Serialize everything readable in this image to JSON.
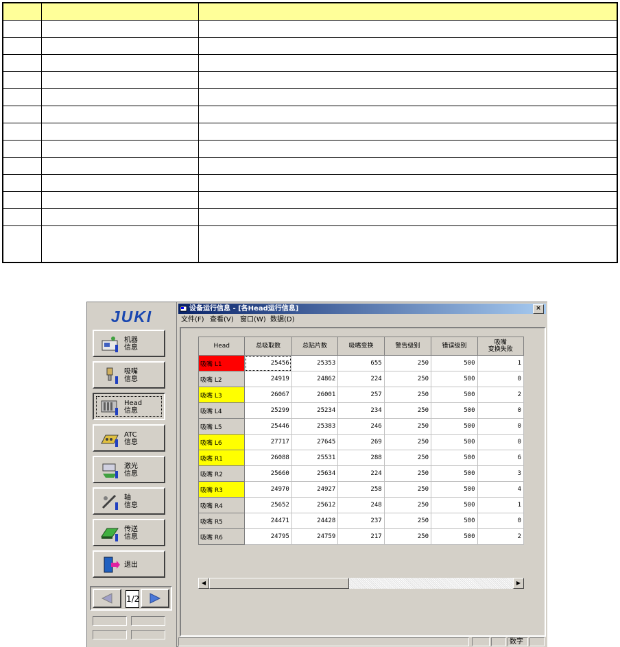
{
  "doc_table": {
    "row_count": 13,
    "header_color": "#ffff99"
  },
  "app": {
    "logo": "JUKI",
    "side_buttons": [
      {
        "name": "machine-info",
        "label": "机器\n信息",
        "icon": "machine-icon"
      },
      {
        "name": "nozzle-info",
        "label": "吸嘴\n信息",
        "icon": "nozzle-icon"
      },
      {
        "name": "head-info",
        "label": "Head\n信息",
        "icon": "head-icon"
      },
      {
        "name": "atc-info",
        "label": "ATC\n信息",
        "icon": "atc-icon"
      },
      {
        "name": "laser-info",
        "label": "激光\n信息",
        "icon": "laser-icon"
      },
      {
        "name": "axis-info",
        "label": "轴\n信息",
        "icon": "axis-icon"
      },
      {
        "name": "transport-info",
        "label": "传送\n信息",
        "icon": "conveyor-icon"
      },
      {
        "name": "exit",
        "label": "退出",
        "icon": "exit-door-icon"
      }
    ],
    "pager": {
      "page": "1/2"
    },
    "window": {
      "title": "设备运行信息 - [各Head运行信息]",
      "close": "×",
      "menu": [
        "文件(F)",
        "查看(V)",
        "窗口(W)",
        "数据(D)"
      ],
      "status": {
        "mode": "数字"
      }
    }
  },
  "grid": {
    "columns": [
      "Head",
      "总吸取数",
      "总贴片数",
      "吸嘴变换",
      "警告级别",
      "错误级别",
      "吸嘴\n变换失败"
    ],
    "rows": [
      {
        "head": "吸嘴 L1",
        "highlight": "red",
        "values": [
          "25456",
          "25353",
          "655",
          "250",
          "500",
          "1"
        ]
      },
      {
        "head": "吸嘴 L2",
        "highlight": "none",
        "values": [
          "24919",
          "24862",
          "224",
          "250",
          "500",
          "0"
        ]
      },
      {
        "head": "吸嘴 L3",
        "highlight": "yellow",
        "values": [
          "26067",
          "26001",
          "257",
          "250",
          "500",
          "2"
        ]
      },
      {
        "head": "吸嘴 L4",
        "highlight": "none",
        "values": [
          "25299",
          "25234",
          "234",
          "250",
          "500",
          "0"
        ]
      },
      {
        "head": "吸嘴 L5",
        "highlight": "none",
        "values": [
          "25446",
          "25383",
          "246",
          "250",
          "500",
          "0"
        ]
      },
      {
        "head": "吸嘴 L6",
        "highlight": "yellow",
        "values": [
          "27717",
          "27645",
          "269",
          "250",
          "500",
          "0"
        ]
      },
      {
        "head": "吸嘴 R1",
        "highlight": "yellow",
        "values": [
          "26088",
          "25531",
          "288",
          "250",
          "500",
          "6"
        ]
      },
      {
        "head": "吸嘴 R2",
        "highlight": "none",
        "values": [
          "25660",
          "25634",
          "224",
          "250",
          "500",
          "3"
        ]
      },
      {
        "head": "吸嘴 R3",
        "highlight": "yellow",
        "values": [
          "24970",
          "24927",
          "258",
          "250",
          "500",
          "4"
        ]
      },
      {
        "head": "吸嘴 R4",
        "highlight": "none",
        "values": [
          "25652",
          "25612",
          "248",
          "250",
          "500",
          "1"
        ]
      },
      {
        "head": "吸嘴 R5",
        "highlight": "none",
        "values": [
          "24471",
          "24428",
          "237",
          "250",
          "500",
          "0"
        ]
      },
      {
        "head": "吸嘴 R6",
        "highlight": "none",
        "values": [
          "24795",
          "24759",
          "217",
          "250",
          "500",
          "2"
        ]
      }
    ]
  },
  "colors": {
    "alarm_red": "#ff0000",
    "warn_yellow": "#ffff00",
    "title_blue": "#0a246a"
  }
}
